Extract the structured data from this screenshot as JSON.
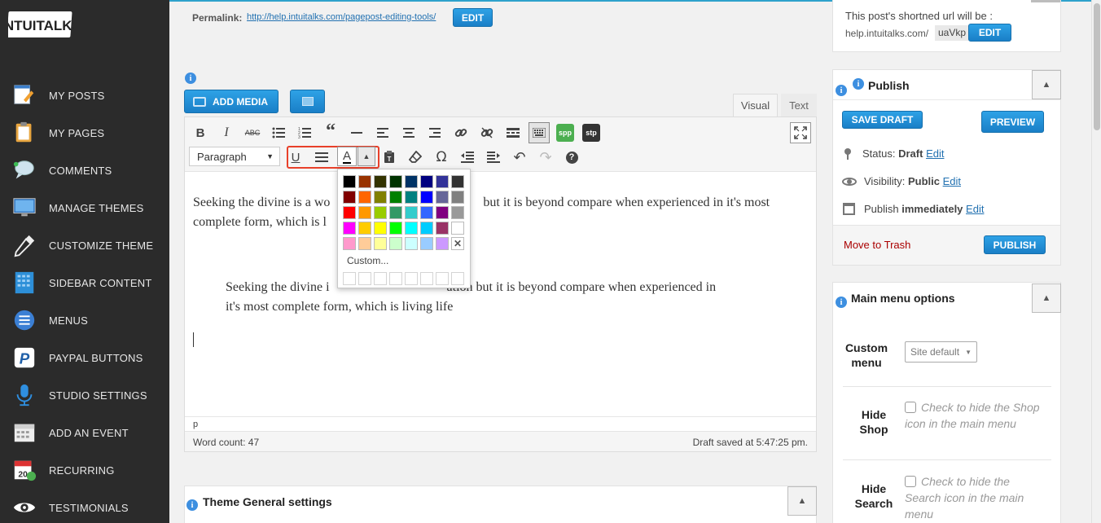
{
  "sidebar": {
    "logo_text": "INTUITALKS",
    "items": [
      {
        "label": "MY POSTS",
        "icon": "notepad-pencil-icon"
      },
      {
        "label": "MY PAGES",
        "icon": "clipboard-icon"
      },
      {
        "label": "COMMENTS",
        "icon": "speech-bubble-icon"
      },
      {
        "label": "MANAGE THEMES",
        "icon": "monitor-icon"
      },
      {
        "label": "CUSTOMIZE THEME",
        "icon": "eyedropper-icon"
      },
      {
        "label": "SIDEBAR CONTENT",
        "icon": "sidebar-grid-icon"
      },
      {
        "label": "MENUS",
        "icon": "menu-lines-icon"
      },
      {
        "label": "PAYPAL BUTTONS",
        "icon": "paypal-icon"
      },
      {
        "label": "STUDIO SETTINGS",
        "icon": "microphone-icon"
      },
      {
        "label": "ADD AN EVENT",
        "icon": "calendar-icon"
      },
      {
        "label": "RECURRING",
        "icon": "recurring-calendar-icon"
      },
      {
        "label": "TESTIMONIALS",
        "icon": "eye-icon"
      }
    ]
  },
  "permalink": {
    "label": "Permalink:",
    "url": "http://help.intuitalks.com/pagepost-editing-tools/",
    "edit_label": "EDIT"
  },
  "media": {
    "add_media_label": "ADD MEDIA"
  },
  "editor": {
    "tab_visual": "Visual",
    "tab_text": "Text",
    "format_select": "Paragraph",
    "paragraph1": "Seeking the divine is a wonderful contemplation but it is beyond compare when experienced in it's most complete form, which is living life",
    "paragraph1_line1_a": "Seeking the divine is a wo",
    "paragraph1_line1_b": "but it is beyond compare when experienced in it's most",
    "paragraph1_line2": "complete form, which is l",
    "paragraph2_line1_a": "Seeking the divine i",
    "paragraph2_line1_b": "ation but it is beyond compare when experienced in",
    "paragraph2_line2": "it's most complete form, which is living life",
    "path": "p",
    "word_count": "Word count: 47",
    "draft_saved": "Draft saved at 5:47:25 pm.",
    "toolbar_badge_spp": "spp",
    "toolbar_badge_stp": "stp"
  },
  "palette": {
    "custom_label": "Custom...",
    "rows": [
      [
        "#000000",
        "#993300",
        "#333300",
        "#003300",
        "#003366",
        "#000080",
        "#333399",
        "#333333"
      ],
      [
        "#800000",
        "#ff6600",
        "#808000",
        "#008000",
        "#008080",
        "#0000ff",
        "#666699",
        "#808080"
      ],
      [
        "#ff0000",
        "#ff9900",
        "#99cc00",
        "#339966",
        "#33cccc",
        "#3366ff",
        "#800080",
        "#999999"
      ],
      [
        "#ff00ff",
        "#ffcc00",
        "#ffff00",
        "#00ff00",
        "#00ffff",
        "#00ccff",
        "#993366",
        "#ffffff"
      ],
      [
        "#ff99cc",
        "#ffcc99",
        "#ffff99",
        "#ccffcc",
        "#ccffff",
        "#99ccff",
        "#cc99ff",
        "none"
      ]
    ]
  },
  "shortlink": {
    "line1": "This post's shortned url will be :",
    "prefix": "help.intuitalks.com/",
    "slug": "uaVkp",
    "edit_label": "EDIT"
  },
  "publish": {
    "title": "Publish",
    "save_draft": "SAVE DRAFT",
    "preview": "PREVIEW",
    "status_label": "Status:",
    "status_value": "Draft",
    "visibility_label": "Visibility:",
    "visibility_value": "Public",
    "publish_label": "Publish",
    "publish_value": "immediately",
    "edit": "Edit",
    "trash": "Move to Trash",
    "publish_button": "PUBLISH"
  },
  "main_menu": {
    "title": "Main menu options",
    "custom_menu_label_1": "Custom",
    "custom_menu_label_2": "menu",
    "custom_menu_value": "Site default",
    "hide_shop_label_1": "Hide",
    "hide_shop_label_2": "Shop",
    "hide_shop_text": "Check to hide the Shop icon in the main menu",
    "hide_search_label_1": "Hide",
    "hide_search_label_2": "Search",
    "hide_search_text": "Check to hide the Search icon in the main menu"
  },
  "theme_settings": {
    "title": "Theme General settings"
  },
  "colors": {
    "accent": "#1e8cbe",
    "sidebar_bg": "#2b2b2b",
    "highlight": "#e8402a"
  }
}
